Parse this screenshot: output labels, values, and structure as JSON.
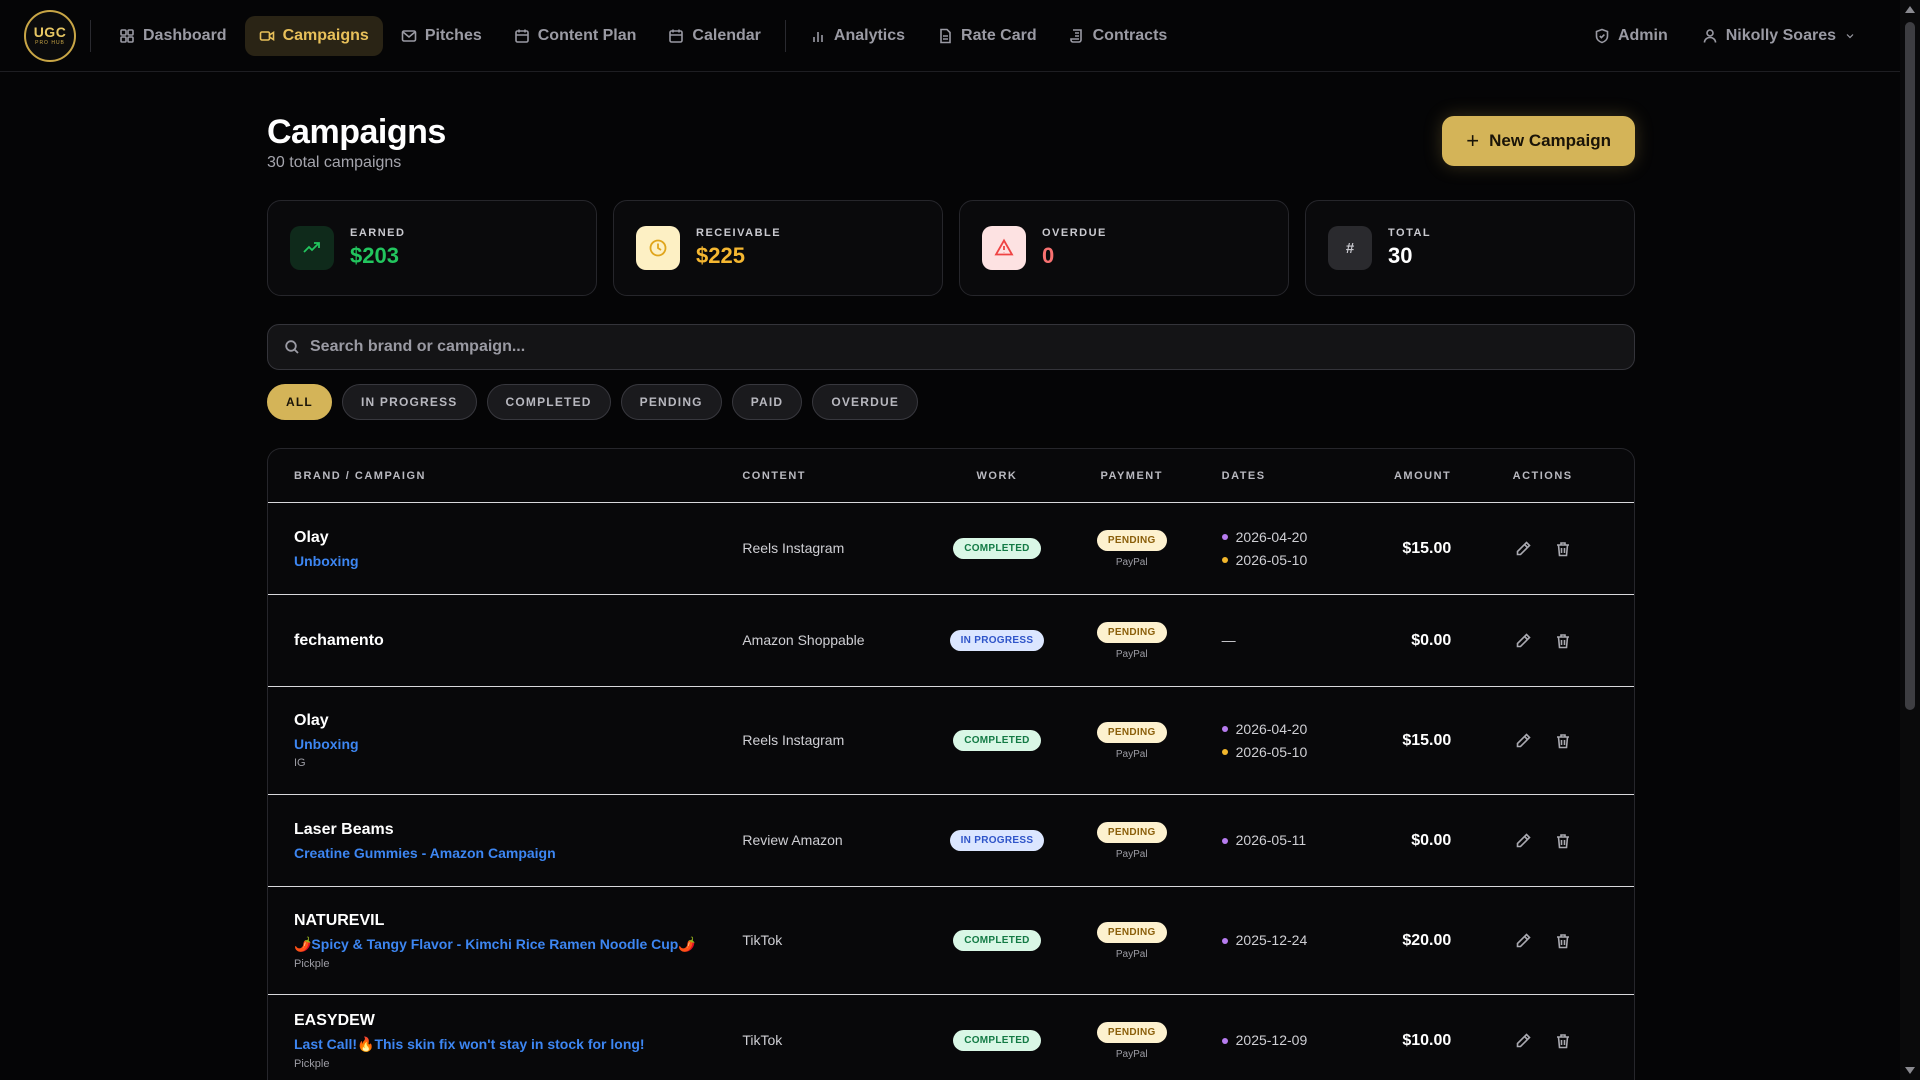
{
  "app": {
    "logo_top": "UGC",
    "logo_bottom": "PRO HUB"
  },
  "nav": {
    "items": [
      {
        "label": "Dashboard",
        "icon": "grid-icon"
      },
      {
        "label": "Campaigns",
        "icon": "video-icon",
        "active": true
      },
      {
        "label": "Pitches",
        "icon": "mail-icon"
      },
      {
        "label": "Content Plan",
        "icon": "calendar-icon"
      },
      {
        "label": "Calendar",
        "icon": "calendar-icon"
      },
      {
        "label": "Analytics",
        "icon": "bar-chart-icon"
      },
      {
        "label": "Rate Card",
        "icon": "document-icon"
      },
      {
        "label": "Contracts",
        "icon": "scroll-icon"
      }
    ],
    "admin_label": "Admin",
    "user_name": "Nikolly Soares"
  },
  "page": {
    "title": "Campaigns",
    "subtitle": "30 total campaigns",
    "new_button": "New Campaign"
  },
  "stats": [
    {
      "label": "EARNED",
      "value": "$203",
      "color": "#22c55e"
    },
    {
      "label": "RECEIVABLE",
      "value": "$225",
      "color": "#f5b731"
    },
    {
      "label": "OVERDUE",
      "value": "0",
      "color": "#f87171"
    },
    {
      "label": "TOTAL",
      "value": "30",
      "color": "#ffffff"
    }
  ],
  "search": {
    "placeholder": "Search brand or campaign..."
  },
  "filters": [
    "ALL",
    "IN PROGRESS",
    "COMPLETED",
    "PENDING",
    "PAID",
    "OVERDUE"
  ],
  "table": {
    "columns": {
      "brand": "BRAND / CAMPAIGN",
      "content": "CONTENT",
      "work": "WORK",
      "payment": "PAYMENT",
      "dates": "DATES",
      "amount": "AMOUNT",
      "actions": "ACTIONS"
    },
    "rows": [
      {
        "brand": "Olay",
        "campaign": "Unboxing",
        "extra": "",
        "content": "Reels Instagram",
        "work": "COMPLETED",
        "payment": "PENDING",
        "method": "PayPal",
        "date1": "2026-04-20",
        "date2": "2026-05-10",
        "dash": "",
        "amount": "$15.00"
      },
      {
        "brand": "fechamento",
        "campaign": "",
        "extra": "",
        "content": "Amazon Shoppable",
        "work": "IN PROGRESS",
        "payment": "PENDING",
        "method": "PayPal",
        "date1": "",
        "date2": "",
        "dash": "—",
        "amount": "$0.00"
      },
      {
        "brand": "Olay",
        "campaign": "Unboxing",
        "extra": "IG",
        "content": "Reels Instagram",
        "work": "COMPLETED",
        "payment": "PENDING",
        "method": "PayPal",
        "date1": "2026-04-20",
        "date2": "2026-05-10",
        "dash": "",
        "amount": "$15.00"
      },
      {
        "brand": "Laser Beams",
        "campaign": "Creatine Gummies - Amazon Campaign",
        "extra": "",
        "content": "Review Amazon",
        "work": "IN PROGRESS",
        "payment": "PENDING",
        "method": "PayPal",
        "date1": "2026-05-11",
        "date2": "",
        "dash": "",
        "amount": "$0.00"
      },
      {
        "brand": "NATUREVIL",
        "campaign": "🌶️Spicy & Tangy Flavor - Kimchi Rice Ramen Noodle Cup🌶️",
        "extra": "Pickple",
        "content": "TikTok",
        "work": "COMPLETED",
        "payment": "PENDING",
        "method": "PayPal",
        "date1": "2025-12-24",
        "date2": "",
        "dash": "",
        "amount": "$20.00"
      },
      {
        "brand": "EASYDEW",
        "campaign": "Last Call!🔥This skin fix won't stay in stock for long!",
        "extra": "Pickple",
        "content": "TikTok",
        "work": "COMPLETED",
        "payment": "PENDING",
        "method": "PayPal",
        "date1": "2025-12-09",
        "date2": "",
        "dash": "",
        "amount": "$10.00"
      }
    ]
  }
}
